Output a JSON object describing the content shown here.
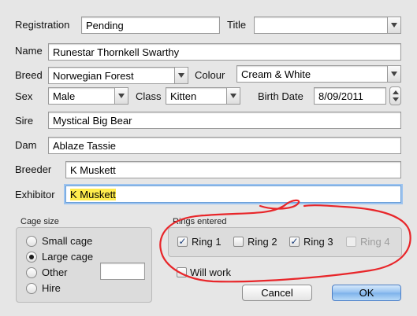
{
  "form": {
    "registration": {
      "label": "Registration",
      "value": "Pending"
    },
    "title": {
      "label": "Title",
      "value": ""
    },
    "name": {
      "label": "Name",
      "value": "Runestar Thornkell Swarthy"
    },
    "breed": {
      "label": "Breed",
      "value": "Norwegian Forest"
    },
    "colour": {
      "label": "Colour",
      "value": "Cream & White"
    },
    "sex": {
      "label": "Sex",
      "value": "Male"
    },
    "class": {
      "label": "Class",
      "value": "Kitten"
    },
    "birth_date": {
      "label": "Birth Date",
      "value": "8/09/2011"
    },
    "sire": {
      "label": "Sire",
      "value": "Mystical Big Bear"
    },
    "dam": {
      "label": "Dam",
      "value": "Ablaze Tassie"
    },
    "breeder": {
      "label": "Breeder",
      "value": "K Muskett"
    },
    "exhibitor": {
      "label": "Exhibitor",
      "value": "K Muskett"
    }
  },
  "cage_size": {
    "title": "Cage size",
    "options": [
      {
        "label": "Small cage",
        "selected": false
      },
      {
        "label": "Large cage",
        "selected": true
      },
      {
        "label": "Other",
        "selected": false
      },
      {
        "label": "Hire",
        "selected": false
      }
    ],
    "other_value": ""
  },
  "rings": {
    "title": "Rings entered",
    "items": [
      {
        "label": "Ring 1",
        "checked": true,
        "enabled": true
      },
      {
        "label": "Ring 2",
        "checked": false,
        "enabled": true
      },
      {
        "label": "Ring 3",
        "checked": true,
        "enabled": true
      },
      {
        "label": "Ring 4",
        "checked": false,
        "enabled": false
      }
    ],
    "will_work": {
      "label": "Will work",
      "checked": false
    }
  },
  "buttons": {
    "cancel": "Cancel",
    "ok": "OK"
  },
  "colors": {
    "annotation": "#e8262a",
    "highlight": "#ffec4d",
    "focus_ring": "#9cc3ef"
  },
  "icons": {
    "checkmark": "check-mark-icon",
    "dropdown": "chevron-down-icon"
  }
}
